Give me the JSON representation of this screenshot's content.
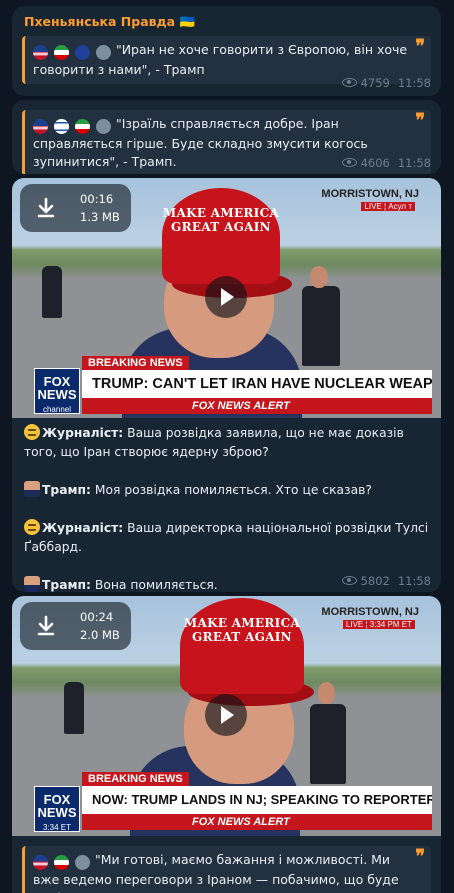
{
  "channel": {
    "name": "Пхеньянська Правда",
    "flag_emoji": "🇺🇦",
    "accent": "#ff9d2f"
  },
  "messages": [
    {
      "quote_text": "\"Иран не хоче говорити з Європою, він хоче говорити з нами\", - Трамп",
      "views": "4759",
      "time": "11:58"
    },
    {
      "quote_text": "\"Ізраїль справляється добре. Іран справляється гірше. Буде складно змусити когось зупинитися\", - Трамп.",
      "views": "4606",
      "time": "11:58"
    },
    {
      "video": {
        "duration": "00:16",
        "size": "1.3 MB",
        "cap_text": "MAKE AMERICA GREAT AGAIN",
        "location": "MORRISTOWN, NJ",
        "live": "LIVE ¦ Асул т",
        "breaking": "BREAKING NEWS",
        "headline": "TRUMP: CAN'T LET IRAN HAVE NUCLEAR WEAPON",
        "network": "FOX NEWS",
        "network_sub": "channel",
        "alert": "FOX NEWS ALERT"
      },
      "dialogue": [
        {
          "emoji": "thinking-face",
          "speaker": "Журналіст:",
          "text": " Ваша розвідка заявила, що не має доказів того, що Іран створює ядерну зброю?"
        },
        {
          "emoji": "trump-photo",
          "speaker": "Трамп:",
          "text": " Моя розвідка помиляється. Хто це сказав?"
        },
        {
          "emoji": "smirking-face",
          "speaker": "Журналіст:",
          "text": " Ваша директорка національної розвідки Тулсі Ґаббард."
        },
        {
          "emoji": "trump-photo",
          "speaker": "Трамп:",
          "text": " Вона помиляється."
        }
      ],
      "views": "5802",
      "time": "11:58"
    },
    {
      "video": {
        "duration": "00:24",
        "size": "2.0 MB",
        "cap_text": "MAKE AMERICA GREAT AGAIN",
        "location": "MORRISTOWN, NJ",
        "live": "LIVE ¦ 3:34 PM ET",
        "breaking": "BREAKING NEWS",
        "headline": "NOW: TRUMP LANDS IN NJ; SPEAKING TO REPORTERS",
        "network": "FOX NEWS",
        "network_sub": "3:34 ET",
        "alert": "FOX NEWS ALERT"
      }
    },
    {
      "quote_text": "\"Ми готові, маємо бажання і можливості. Ми вже ведемо переговори з Іраном — побачимо, що буде далі\", -"
    }
  ],
  "colors": {
    "background": "#0e1621",
    "bubble": "#182533",
    "quote_bg": "#22303f",
    "muted": "#6d7f8f"
  }
}
